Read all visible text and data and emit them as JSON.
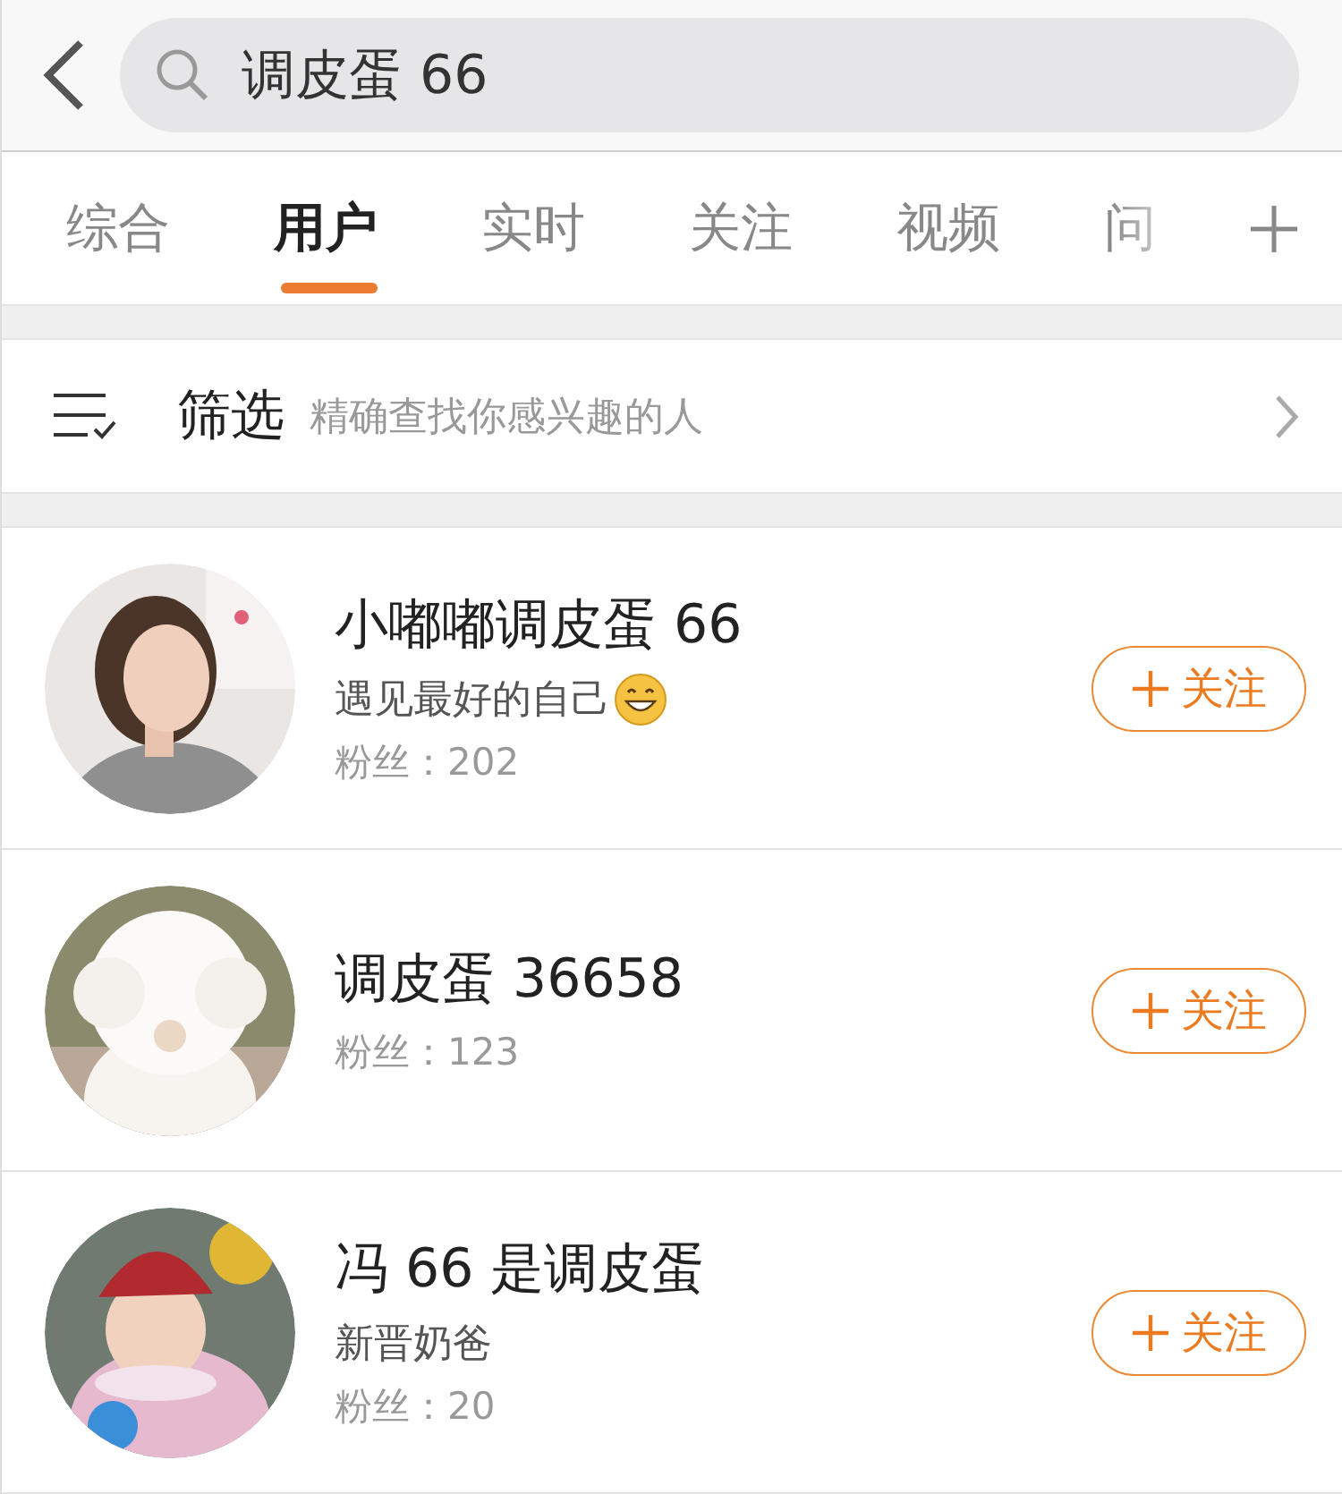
{
  "search": {
    "value": "调皮蛋 66"
  },
  "tabs": [
    {
      "label": "综合",
      "selected": false
    },
    {
      "label": "用户",
      "selected": true
    },
    {
      "label": "实时",
      "selected": false
    },
    {
      "label": "关注",
      "selected": false
    },
    {
      "label": "视频",
      "selected": false
    },
    {
      "label": "问",
      "selected": false
    }
  ],
  "filter": {
    "label": "筛选",
    "hint": "精确查找你感兴趣的人"
  },
  "users": [
    {
      "name": "小嘟嘟调皮蛋 66",
      "bio": "遇见最好的自己",
      "bio_emoji": true,
      "fans": "粉丝：202",
      "follow": "关注"
    },
    {
      "name": "调皮蛋 36658",
      "bio_emoji": false,
      "fans": "粉丝：123",
      "follow": "关注"
    },
    {
      "name": "冯 66 是调皮蛋",
      "bio": "新晋奶爸",
      "bio_emoji": false,
      "fans": "粉丝：20",
      "follow": "关注"
    }
  ]
}
